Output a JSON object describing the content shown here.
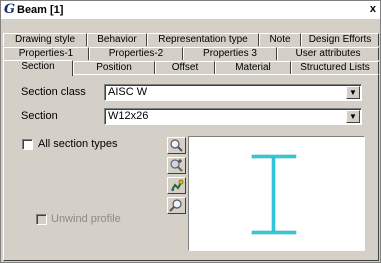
{
  "window": {
    "logo": "G",
    "title": "Beam [1]",
    "close": "x"
  },
  "tabs": {
    "row1": [
      "Drawing style",
      "Behavior",
      "Representation type",
      "Note",
      "Design Efforts"
    ],
    "row2": [
      "Properties-1",
      "Properties-2",
      "Properties 3",
      "User attributes"
    ],
    "row3": [
      "Section",
      "Position",
      "Offset",
      "Material",
      "Structured Lists"
    ],
    "active": "Section"
  },
  "form": {
    "section_class_label": "Section class",
    "section_class_value": "AISC W",
    "section_label": "Section",
    "section_value": "W12x26",
    "all_section_types_label": "All section types",
    "unwind_profile_label": "Unwind profile"
  },
  "tools": [
    "zoom-icon",
    "zoom-in-icon",
    "pan-icon",
    "zoom-fit-icon"
  ],
  "colors": {
    "dialog_bg": "#d4d0c8",
    "profile": "#33ccdd"
  }
}
